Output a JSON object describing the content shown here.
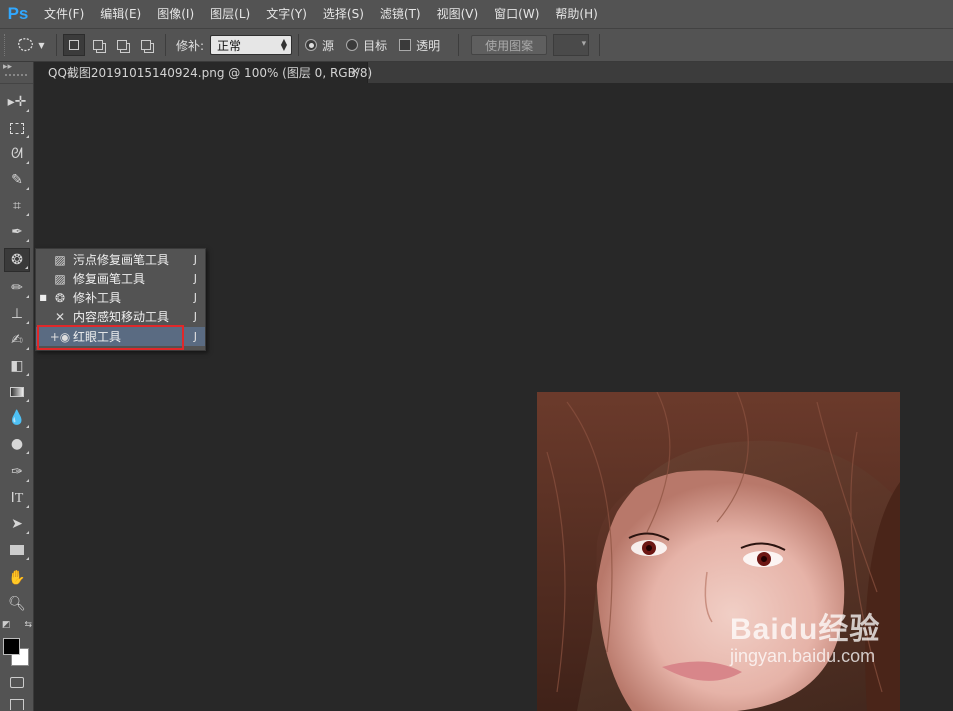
{
  "app": {
    "logo": "Ps",
    "menu": [
      "文件(F)",
      "编辑(E)",
      "图像(I)",
      "图层(L)",
      "文字(Y)",
      "选择(S)",
      "滤镜(T)",
      "视图(V)",
      "窗口(W)",
      "帮助(H)"
    ]
  },
  "options_bar": {
    "tool_icon": "patch-icon",
    "patch_label": "修补:",
    "patch_mode_value": "正常",
    "radio_source_label": "源",
    "radio_source_selected": true,
    "radio_target_label": "目标",
    "radio_target_selected": false,
    "transparent_label": "透明",
    "transparent_checked": false,
    "use_pattern_label": "使用图案"
  },
  "document": {
    "tab_title": "QQ截图20191015140924.png @ 100% (图层 0, RGB/8)",
    "close_glyph": "×"
  },
  "flyout": {
    "items": [
      {
        "label": "污点修复画笔工具",
        "shortcut": "J",
        "icon": "spot-healing-brush-icon",
        "active": false,
        "highlighted": false
      },
      {
        "label": "修复画笔工具",
        "shortcut": "J",
        "icon": "healing-brush-icon",
        "active": false,
        "highlighted": false
      },
      {
        "label": "修补工具",
        "shortcut": "J",
        "icon": "patch-icon",
        "active": true,
        "highlighted": false
      },
      {
        "label": "内容感知移动工具",
        "shortcut": "J",
        "icon": "content-aware-move-icon",
        "active": false,
        "highlighted": false
      },
      {
        "label": "红眼工具",
        "shortcut": "J",
        "icon": "red-eye-icon",
        "active": false,
        "highlighted": true
      }
    ],
    "annotation_color": "#e0282a"
  },
  "watermark": {
    "main": "Baidu经验",
    "sub": "jingyan.baidu.com"
  },
  "colors": {
    "fg": "#000000",
    "bg": "#ffffff",
    "ps_blue": "#31a8ff",
    "highlight": "#5a6b82"
  }
}
